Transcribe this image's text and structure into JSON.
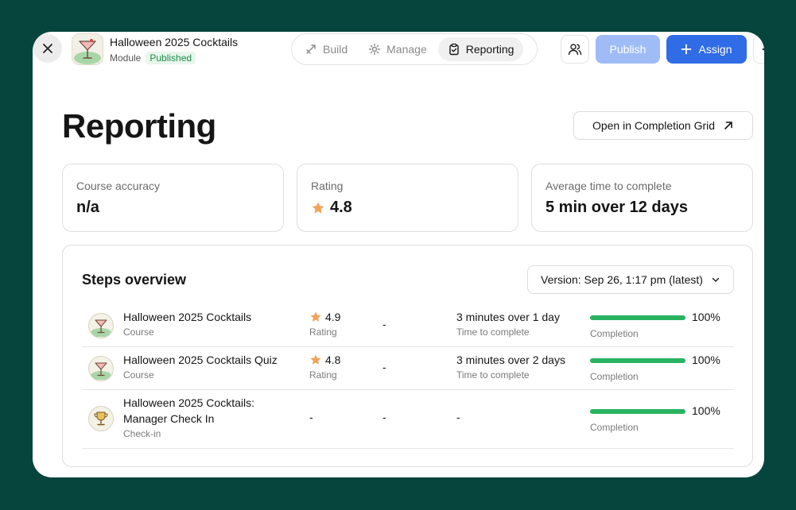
{
  "header": {
    "module_title": "Halloween 2025 Cocktails",
    "module_type": "Module",
    "status_badge": "Published",
    "tabs": [
      {
        "label": "Build",
        "icon": "build-icon"
      },
      {
        "label": "Manage",
        "icon": "gear-icon"
      },
      {
        "label": "Reporting",
        "icon": "clipboard-icon"
      }
    ],
    "active_tab": "Reporting",
    "publish_label": "Publish",
    "assign_label": "Assign"
  },
  "page": {
    "title": "Reporting",
    "completion_grid_label": "Open in Completion Grid"
  },
  "stats": [
    {
      "label": "Course accuracy",
      "value": "n/a"
    },
    {
      "label": "Rating",
      "value": "4.8",
      "icon": "star-icon"
    },
    {
      "label": "Average time to complete",
      "value": "5 min over 12 days"
    }
  ],
  "steps_overview": {
    "title": "Steps overview",
    "version_label": "Version: Sep 26, 1:17 pm (latest)",
    "rows": [
      {
        "name": "Halloween 2025 Cocktails",
        "type": "Course",
        "rating": "4.9",
        "rating_label": "Rating",
        "middle": "-",
        "time": "3 minutes over 1 day",
        "time_label": "Time to complete",
        "completion": "100%",
        "completion_fraction": 1.0,
        "completion_label": "Completion",
        "thumb": "cocktail-icon"
      },
      {
        "name": "Halloween 2025 Cocktails Quiz",
        "type": "Course",
        "rating": "4.8",
        "rating_label": "Rating",
        "middle": "-",
        "time": "3 minutes over 2 days",
        "time_label": "Time to complete",
        "completion": "100%",
        "completion_fraction": 1.0,
        "completion_label": "Completion",
        "thumb": "cocktail-icon"
      },
      {
        "name": "Halloween 2025 Cocktails: Manager Check In",
        "type": "Check-in",
        "rating": "-",
        "middle": "-",
        "time": "-",
        "completion": "100%",
        "completion_fraction": 1.0,
        "completion_label": "Completion",
        "thumb": "trophy-icon"
      }
    ]
  },
  "colors": {
    "background": "#06453d",
    "accent": "#2f6ce6",
    "publish_disabled": "#9fbcf6",
    "progress": "#29b360",
    "star": "#f2a35a",
    "published_text": "#1d8a47"
  }
}
